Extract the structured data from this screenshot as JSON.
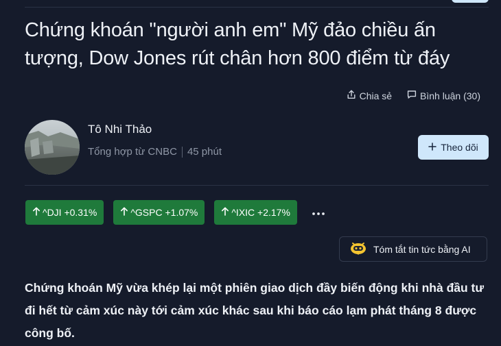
{
  "article": {
    "title": "Chứng khoán \"người anh em\" Mỹ đảo chiều ấn tượng, Dow Jones rút chân hơn 800 điểm từ đáy",
    "share_label": "Chia sẻ",
    "comment_label": "Bình luận (30)",
    "lead": "Chứng khoán Mỹ vừa khép lại một phiên giao dịch đầy biến động khi nhà đầu tư đi hết từ cảm xúc này tới cảm xúc khác sau khi báo cáo lạm phát tháng 8 được công bố."
  },
  "author": {
    "name": "Tô Nhi Thảo",
    "source": "Tổng hợp từ CNBC",
    "time": "45 phút",
    "follow_label": "Theo dõi"
  },
  "tickers": [
    {
      "label": "^DJI +0.31%",
      "direction": "up"
    },
    {
      "label": "^GSPC +1.07%",
      "direction": "up"
    },
    {
      "label": "^IXIC +2.17%",
      "direction": "up"
    }
  ],
  "ai_summary": {
    "label": "Tóm tắt tin tức bằng AI"
  },
  "colors": {
    "background": "#151b2b",
    "ticker_up": "#1f7a3b",
    "follow_button": "#cfe7fb",
    "ai_icon": "#f4c430"
  }
}
